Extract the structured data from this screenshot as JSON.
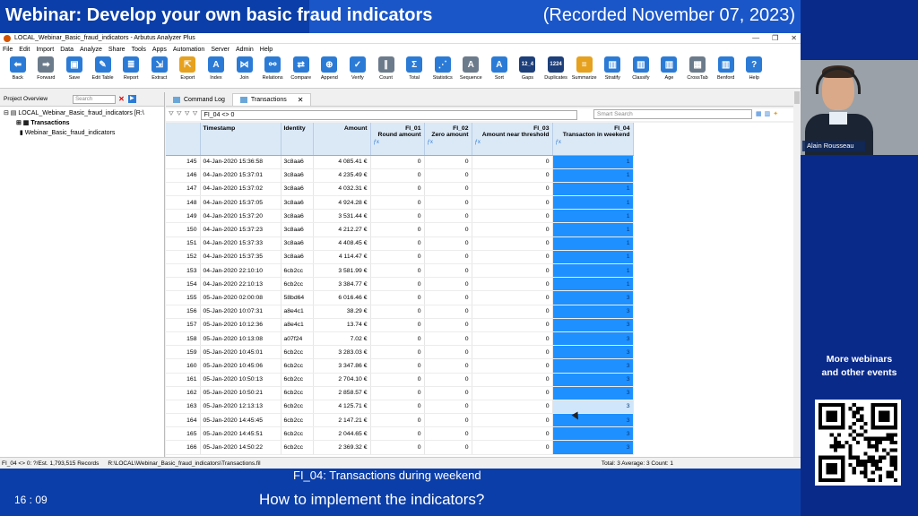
{
  "banner": {
    "title": "Webinar: Develop your own basic fraud indicators",
    "date": "(Recorded November 07, 2023)"
  },
  "window": {
    "title": "LOCAL_Webinar_Basic_fraud_indicators - Arbutus Analyzer Plus",
    "controls": [
      "—",
      "❐",
      "✕"
    ]
  },
  "menu": [
    "File",
    "Edit",
    "Import",
    "Data",
    "Analyze",
    "Share",
    "Tools",
    "Apps",
    "Automation",
    "Server",
    "Admin",
    "Help"
  ],
  "toolbar": [
    {
      "label": "Back",
      "icon": "back-arrow-icon",
      "glyph": "⬅",
      "color": "blue"
    },
    {
      "label": "Forward",
      "icon": "forward-arrow-icon",
      "glyph": "➡",
      "color": "gray"
    },
    {
      "label": "Save",
      "icon": "save-icon",
      "glyph": "▣",
      "color": "blue"
    },
    {
      "label": "Edit Table",
      "icon": "edit-table-icon",
      "glyph": "✎",
      "color": "blue"
    },
    {
      "label": "Report",
      "icon": "report-icon",
      "glyph": "≣",
      "color": "blue"
    },
    {
      "label": "Extract",
      "icon": "extract-icon",
      "glyph": "⇲",
      "color": "blue"
    },
    {
      "label": "Export",
      "icon": "export-icon",
      "glyph": "⇱",
      "color": "orange"
    },
    {
      "label": "Index",
      "icon": "index-icon",
      "glyph": "A",
      "color": "blue"
    },
    {
      "label": "Join",
      "icon": "join-icon",
      "glyph": "⋈",
      "color": "blue"
    },
    {
      "label": "Relations",
      "icon": "relations-icon",
      "glyph": "⚯",
      "color": "blue"
    },
    {
      "label": "Compare",
      "icon": "compare-icon",
      "glyph": "⇄",
      "color": "blue"
    },
    {
      "label": "Append",
      "icon": "append-icon",
      "glyph": "⊕",
      "color": "blue"
    },
    {
      "label": "Verify",
      "icon": "verify-icon",
      "glyph": "✓",
      "color": "blue"
    },
    {
      "label": "Count",
      "icon": "count-icon",
      "glyph": "∥",
      "color": "gray"
    },
    {
      "label": "Total",
      "icon": "total-icon",
      "glyph": "Σ",
      "color": "blue"
    },
    {
      "label": "Statistics",
      "icon": "statistics-icon",
      "glyph": "⋰",
      "color": "blue"
    },
    {
      "label": "Sequence",
      "icon": "sequence-icon",
      "glyph": "A",
      "color": "gray"
    },
    {
      "label": "Sort",
      "icon": "sort-icon",
      "glyph": "A",
      "color": "blue"
    },
    {
      "label": "Gaps",
      "icon": "gaps-icon",
      "glyph": "12_4",
      "color": "dark"
    },
    {
      "label": "Duplicates",
      "icon": "duplicates-icon",
      "glyph": "1224",
      "color": "dark"
    },
    {
      "label": "Summarize",
      "icon": "summarize-icon",
      "glyph": "≡",
      "color": "orange"
    },
    {
      "label": "Stratify",
      "icon": "stratify-icon",
      "glyph": "▥",
      "color": "blue"
    },
    {
      "label": "Classify",
      "icon": "classify-icon",
      "glyph": "▥",
      "color": "blue"
    },
    {
      "label": "Age",
      "icon": "age-icon",
      "glyph": "▥",
      "color": "blue"
    },
    {
      "label": "CrossTab",
      "icon": "crosstab-icon",
      "glyph": "▦",
      "color": "gray"
    },
    {
      "label": "Benford",
      "icon": "benford-icon",
      "glyph": "▥",
      "color": "blue"
    },
    {
      "label": "Help",
      "icon": "help-icon",
      "glyph": "?",
      "color": "blue"
    }
  ],
  "project": {
    "header": "Project Overview",
    "search_placeholder": "Search",
    "root": "LOCAL_Webinar_Basic_fraud_indicators [R:\\",
    "items": [
      "Transactions",
      "Webinar_Basic_fraud_indicators"
    ]
  },
  "tabs": [
    {
      "label": "Command Log",
      "active": false
    },
    {
      "label": "Transactions",
      "active": true
    }
  ],
  "filter": {
    "expression": "FI_04 <> 0",
    "smart_search_placeholder": "Smart Search"
  },
  "table": {
    "headers": [
      {
        "title": "",
        "sub": "",
        "fx": false
      },
      {
        "title": "Timestamp",
        "sub": "",
        "fx": false
      },
      {
        "title": "Identity",
        "sub": "",
        "fx": false
      },
      {
        "title": "Amount",
        "sub": "",
        "fx": false
      },
      {
        "title": "FI_01",
        "sub": "Round amount",
        "fx": true
      },
      {
        "title": "FI_02",
        "sub": "Zero amount",
        "fx": true
      },
      {
        "title": "FI_03",
        "sub": "Amount near threshold",
        "fx": true
      },
      {
        "title": "FI_04",
        "sub": "Transacton in weekend",
        "fx": true
      }
    ],
    "rows": [
      [
        "145",
        "04-Jan-2020 15:36:58",
        "3c8aa6",
        "4 085.41 €",
        "0",
        "0",
        "0",
        "1"
      ],
      [
        "146",
        "04-Jan-2020 15:37:01",
        "3c8aa6",
        "4 235.49 €",
        "0",
        "0",
        "0",
        "1"
      ],
      [
        "147",
        "04-Jan-2020 15:37:02",
        "3c8aa6",
        "4 032.31 €",
        "0",
        "0",
        "0",
        "1"
      ],
      [
        "148",
        "04-Jan-2020 15:37:05",
        "3c8aa6",
        "4 924.28 €",
        "0",
        "0",
        "0",
        "1"
      ],
      [
        "149",
        "04-Jan-2020 15:37:20",
        "3c8aa6",
        "3 531.44 €",
        "0",
        "0",
        "0",
        "1"
      ],
      [
        "150",
        "04-Jan-2020 15:37:23",
        "3c8aa6",
        "4 212.27 €",
        "0",
        "0",
        "0",
        "1"
      ],
      [
        "151",
        "04-Jan-2020 15:37:33",
        "3c8aa6",
        "4 408.45 €",
        "0",
        "0",
        "0",
        "1"
      ],
      [
        "152",
        "04-Jan-2020 15:37:35",
        "3c8aa6",
        "4 114.47 €",
        "0",
        "0",
        "0",
        "1"
      ],
      [
        "153",
        "04-Jan-2020 22:10:10",
        "6cb2cc",
        "3 581.99 €",
        "0",
        "0",
        "0",
        "1"
      ],
      [
        "154",
        "04-Jan-2020 22:10:13",
        "6cb2cc",
        "3 384.77 €",
        "0",
        "0",
        "0",
        "1"
      ],
      [
        "155",
        "05-Jan-2020 02:00:08",
        "58bd64",
        "6 016.46 €",
        "0",
        "0",
        "0",
        "3"
      ],
      [
        "156",
        "05-Jan-2020 10:07:31",
        "a8e4c1",
        "38.29 €",
        "0",
        "0",
        "0",
        "3"
      ],
      [
        "157",
        "05-Jan-2020 10:12:36",
        "a8e4c1",
        "13.74 €",
        "0",
        "0",
        "0",
        "3"
      ],
      [
        "158",
        "05-Jan-2020 10:13:08",
        "a07f24",
        "7.02 €",
        "0",
        "0",
        "0",
        "3"
      ],
      [
        "159",
        "05-Jan-2020 10:45:01",
        "6cb2cc",
        "3 283.03 €",
        "0",
        "0",
        "0",
        "3"
      ],
      [
        "160",
        "05-Jan-2020 10:45:06",
        "6cb2cc",
        "3 347.86 €",
        "0",
        "0",
        "0",
        "3"
      ],
      [
        "161",
        "05-Jan-2020 10:50:13",
        "6cb2cc",
        "2 704.10 €",
        "0",
        "0",
        "0",
        "3"
      ],
      [
        "162",
        "05-Jan-2020 10:50:21",
        "6cb2cc",
        "2 858.57 €",
        "0",
        "0",
        "0",
        "3"
      ],
      [
        "163",
        "05-Jan-2020 12:13:13",
        "6cb2cc",
        "4 125.71 €",
        "0",
        "0",
        "0",
        "3"
      ],
      [
        "164",
        "05-Jan-2020 14:45:45",
        "6cb2cc",
        "2 147.21 €",
        "0",
        "0",
        "0",
        "3"
      ],
      [
        "165",
        "05-Jan-2020 14:45:51",
        "6cb2cc",
        "2 044.65 €",
        "0",
        "0",
        "0",
        "3"
      ],
      [
        "166",
        "05-Jan-2020 14:50:22",
        "6cb2cc",
        "2 369.32 €",
        "0",
        "0",
        "0",
        "3"
      ]
    ],
    "selected_row": "163"
  },
  "status": {
    "left": "FI_04 <> 0: ?/Est. 1,793,515 Records",
    "path": "R:\\LOCAL\\Webinar_Basic_fraud_indicators\\Transactions.fil",
    "right": "Total: 3  Average: 3  Count: 1"
  },
  "caption": "FI_04: Transactions during weekend",
  "bottom": {
    "clock": "16 : 09",
    "question": "How to implement the indicators?"
  },
  "side": {
    "presenter": "Alain Rousseau",
    "more": "More webinars\nand other events"
  },
  "colors": {
    "brand_blue": "#0b3ea8",
    "highlight": "#1e90ff"
  }
}
